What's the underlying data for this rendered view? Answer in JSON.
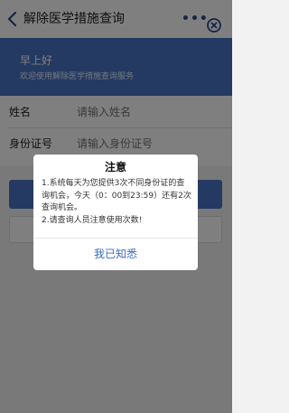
{
  "navbar": {
    "title": "解除医学措施查询",
    "back_icon": "chevron-left-icon",
    "more_label": "•••",
    "close_icon": "close-circle-icon"
  },
  "banner": {
    "greeting": "早上好",
    "welcome": "欢迎使用解除医学措施查询服务",
    "bg_color": "#4a75c4"
  },
  "form": {
    "name_label": "姓名",
    "name_placeholder": "请输入姓名",
    "id_label": "身份证号",
    "id_placeholder": "请输入身份证号"
  },
  "dialog": {
    "title": "注意",
    "line1": "1.系统每天为您提供3次不同身份证的查询机会，今天（0：00到23:59）还有2次查询机会。",
    "line2": "2.请查询人员注意使用次数!",
    "confirm_label": "我已知悉",
    "accent_color": "#3d6bc0"
  }
}
